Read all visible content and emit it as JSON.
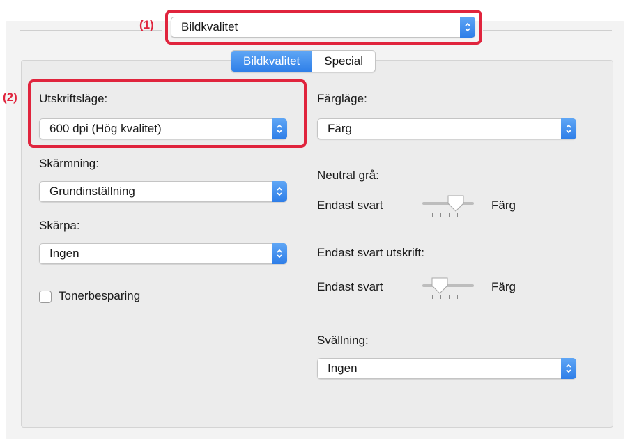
{
  "top_popup": {
    "value": "Bildkvalitet",
    "callout": "(1)"
  },
  "tabs": [
    {
      "label": "Bildkvalitet",
      "active": true
    },
    {
      "label": "Special",
      "active": false
    }
  ],
  "left": {
    "callout": "(2)",
    "print_mode": {
      "label": "Utskriftsläge:",
      "value": "600 dpi (Hög kvalitet)"
    },
    "screening": {
      "label": "Skärmning:",
      "value": "Grundinställning"
    },
    "sharpness": {
      "label": "Skärpa:",
      "value": "Ingen"
    },
    "toner_saving": {
      "label": "Tonerbesparing",
      "checked": false
    }
  },
  "right": {
    "color_mode": {
      "label": "Färgläge:",
      "value": "Färg"
    },
    "neutral_gray": {
      "label": "Neutral grå:",
      "left": "Endast svart",
      "right": "Färg"
    },
    "black_only_print": {
      "label": "Endast svart utskrift:",
      "left": "Endast svart",
      "right": "Färg"
    },
    "swelling": {
      "label": "Svällning:",
      "value": "Ingen"
    }
  },
  "colors": {
    "accent": "#2f7fe8",
    "callout": "#e0243d"
  }
}
